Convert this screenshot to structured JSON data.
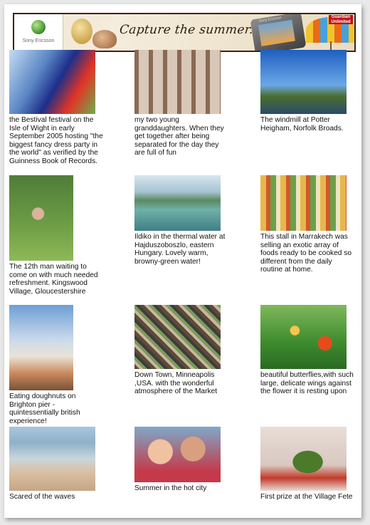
{
  "banner": {
    "brand": "Sony Ericsson",
    "tagline": "Capture the summer...",
    "phone_brand": "Sony Ericsson",
    "partner_line1": "Guardian",
    "partner_line2": "Unlimited"
  },
  "photos": [
    {
      "caption": "the Bestival festival on the Isle of Wight in early September 2005 hosting \"the biggest fancy dress party in the world\" as verified by the Guinness Book of Records."
    },
    {
      "caption": "my two young granddaughters. When they get together after being separated for the day they are full of fun"
    },
    {
      "caption": "The windmill at Potter Heigham, Norfolk Broads."
    },
    {
      "caption": "The 12th man waiting to come on with much needed refreshment. Kingswood Village, Gloucestershire"
    },
    {
      "caption": "Ildiko in the thermal water at Hajduszoboszlo, eastern Hungary. Lovely warm, browny-green water!"
    },
    {
      "caption": "This stall in Marrakech was selling an exotic array of foods ready to be cooked so different from the daily routine at home."
    },
    {
      "caption": "Eating doughnuts on Brighton pier - quintessentially british experience!"
    },
    {
      "caption": "Down Town, Minneapolis ,USA. with the wonderful atmosphere of the Market"
    },
    {
      "caption": "beautiful butterflies,with such large, delicate wings against the flower it is resting upon"
    },
    {
      "caption": "Scared of the waves"
    },
    {
      "caption": "Summer in the hot city"
    },
    {
      "caption": "First prize at the Village Fete"
    }
  ]
}
